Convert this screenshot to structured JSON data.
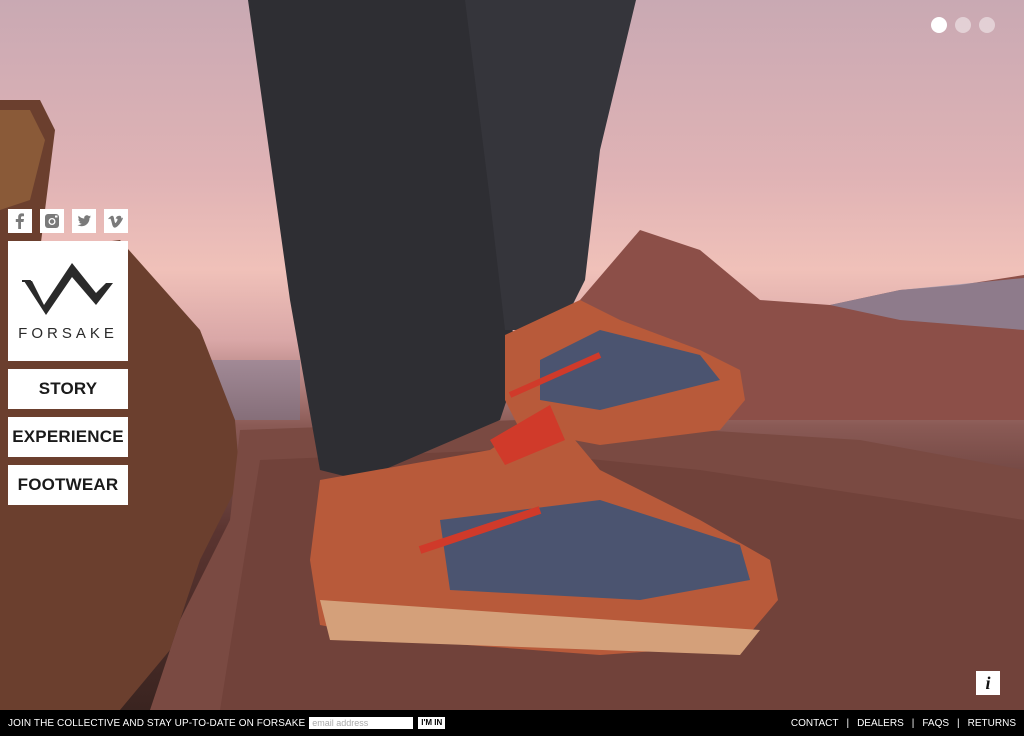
{
  "brand": {
    "name": "FORSAKE"
  },
  "nav": {
    "items": [
      {
        "label": "STORY"
      },
      {
        "label": "EXPERIENCE"
      },
      {
        "label": "FOOTWEAR"
      }
    ]
  },
  "social": [
    "facebook-icon",
    "instagram-icon",
    "twitter-icon",
    "vimeo-icon"
  ],
  "slider": {
    "count": 3,
    "active": 0
  },
  "info": {
    "label": "i"
  },
  "footer": {
    "join_text": "JOIN THE COLLECTIVE AND STAY UP-TO-DATE ON FORSAKE",
    "email_placeholder": "email address",
    "submit_label": "I'M IN",
    "links": [
      {
        "label": "CONTACT"
      },
      {
        "label": "DEALERS"
      },
      {
        "label": "FAQS"
      },
      {
        "label": "RETURNS"
      }
    ]
  },
  "colors": {
    "accent": "#d03a2a",
    "footer_bg": "#000000",
    "panel_bg": "#ffffff"
  }
}
